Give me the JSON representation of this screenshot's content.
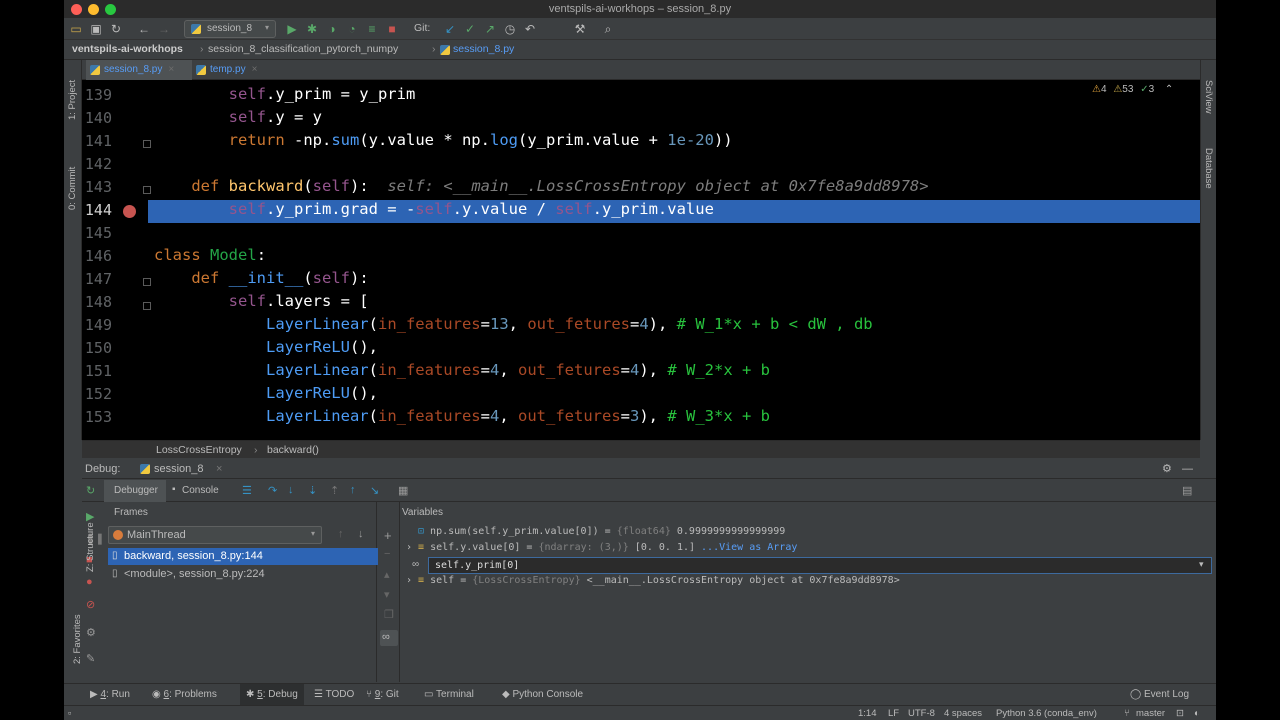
{
  "window": {
    "title": "ventspils-ai-workhops – session_8.py"
  },
  "toolbar": {
    "run_config": "session_8",
    "git_label": "Git:"
  },
  "nav": {
    "project": "ventspils-ai-workhops",
    "folder": "session_8_classification_pytorch_numpy",
    "file": "session_8.py"
  },
  "tabs": [
    {
      "label": "session_8.py",
      "active": true
    },
    {
      "label": "temp.py",
      "active": false
    }
  ],
  "left_strip": {
    "project": "1: Project",
    "commit": "0: Commit",
    "structure": "Z: Structure",
    "favorites": "2: Favorites"
  },
  "right_strip": {
    "sciview": "SciView",
    "database": "Database"
  },
  "inspection": {
    "warnings": "4",
    "weak_warnings": "53",
    "typos": "3"
  },
  "editor": {
    "lines": [
      139,
      140,
      141,
      142,
      143,
      144,
      145,
      146,
      147,
      148,
      149,
      150,
      151,
      152,
      153
    ],
    "current_line": 144,
    "hint_text": "self: <__main__.LossCrossEntropy object at 0x7fe8a9dd8978>"
  },
  "breadcrumb": {
    "class": "LossCrossEntropy",
    "method": "backward()"
  },
  "debug": {
    "title": "Debug:",
    "session": "session_8",
    "tab_debugger": "Debugger",
    "tab_console": "Console",
    "frames_header": "Frames",
    "variables_header": "Variables",
    "thread": "MainThread",
    "frames": [
      {
        "label": "backward, session_8.py:144",
        "selected": true
      },
      {
        "label": "<module>, session_8.py:224",
        "selected": false
      }
    ],
    "variables": [
      {
        "name": "np.sum(self.y_prim.value[0])",
        "eq": " = ",
        "type": "{float64}",
        "value": " 0.9999999999999999"
      },
      {
        "name": "self.y.value[0]",
        "eq": " = ",
        "type": "{ndarray: (3,)}",
        "value": " [0. 0. 1.]",
        "link": " ...View as Array"
      },
      {
        "name": "self",
        "eq": " = ",
        "type": "{LossCrossEntropy}",
        "value": " <__main__.LossCrossEntropy object at 0x7fe8a9dd8978>"
      }
    ],
    "watch_input": "self.y_prim[0]"
  },
  "bottom_tabs": [
    {
      "num": "4",
      "label": ": Run"
    },
    {
      "num": "6",
      "label": ": Problems"
    },
    {
      "num": "5",
      "label": ": Debug"
    },
    {
      "num": "",
      "label": "TODO"
    },
    {
      "num": "9",
      "label": ": Git"
    },
    {
      "num": "",
      "label": "Terminal"
    },
    {
      "num": "",
      "label": "Python Console"
    }
  ],
  "event_log": "Event Log",
  "status": {
    "position": "1:14",
    "line_sep": "LF",
    "encoding": "UTF-8",
    "indent": "4 spaces",
    "interpreter": "Python 3.6 (conda_env)",
    "branch": "master"
  },
  "colors": {
    "selection": "#2d64b4",
    "breakpoint": "#c75450",
    "keyword": "#cc7832",
    "comment": "#28c23d"
  }
}
